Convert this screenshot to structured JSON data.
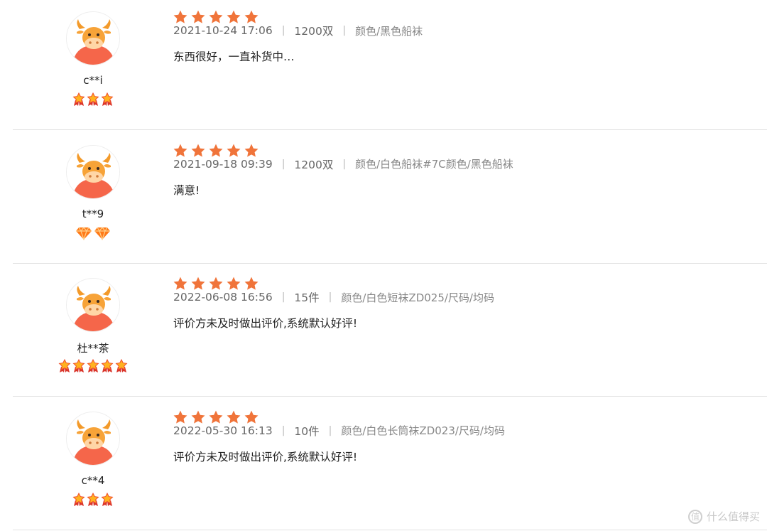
{
  "colors": {
    "star": "#f0743a",
    "medal": "#f04c2b",
    "diamond": "#ff7a18",
    "bull": "#f5664a"
  },
  "reviews": [
    {
      "user": "c**i",
      "rating": 5,
      "level_icon": "medal-icon",
      "level_count": 3,
      "date": "2021-10-24 17:06",
      "quantity": "1200双",
      "spec": "颜色/黑色船袜",
      "content": "东西很好，一直补货中…"
    },
    {
      "user": "t**9",
      "rating": 5,
      "level_icon": "diamond-icon",
      "level_count": 2,
      "date": "2021-09-18 09:39",
      "quantity": "1200双",
      "spec": "颜色/白色船袜#7C颜色/黑色船袜",
      "content": "满意!"
    },
    {
      "user": "杜**茶",
      "rating": 5,
      "level_icon": "medal-icon",
      "level_count": 5,
      "date": "2022-06-08 16:56",
      "quantity": "15件",
      "spec": "颜色/白色短袜ZD025/尺码/均码",
      "content": "评价方未及时做出评价,系统默认好评!"
    },
    {
      "user": "c**4",
      "rating": 5,
      "level_icon": "medal-icon",
      "level_count": 3,
      "date": "2022-05-30 16:13",
      "quantity": "10件",
      "spec": "颜色/白色长筒袜ZD023/尺码/均码",
      "content": "评价方未及时做出评价,系统默认好评!"
    }
  ],
  "separator": "|",
  "watermark": {
    "icon": "zhi-icon",
    "icon_text": "值",
    "text": "什么值得买"
  }
}
